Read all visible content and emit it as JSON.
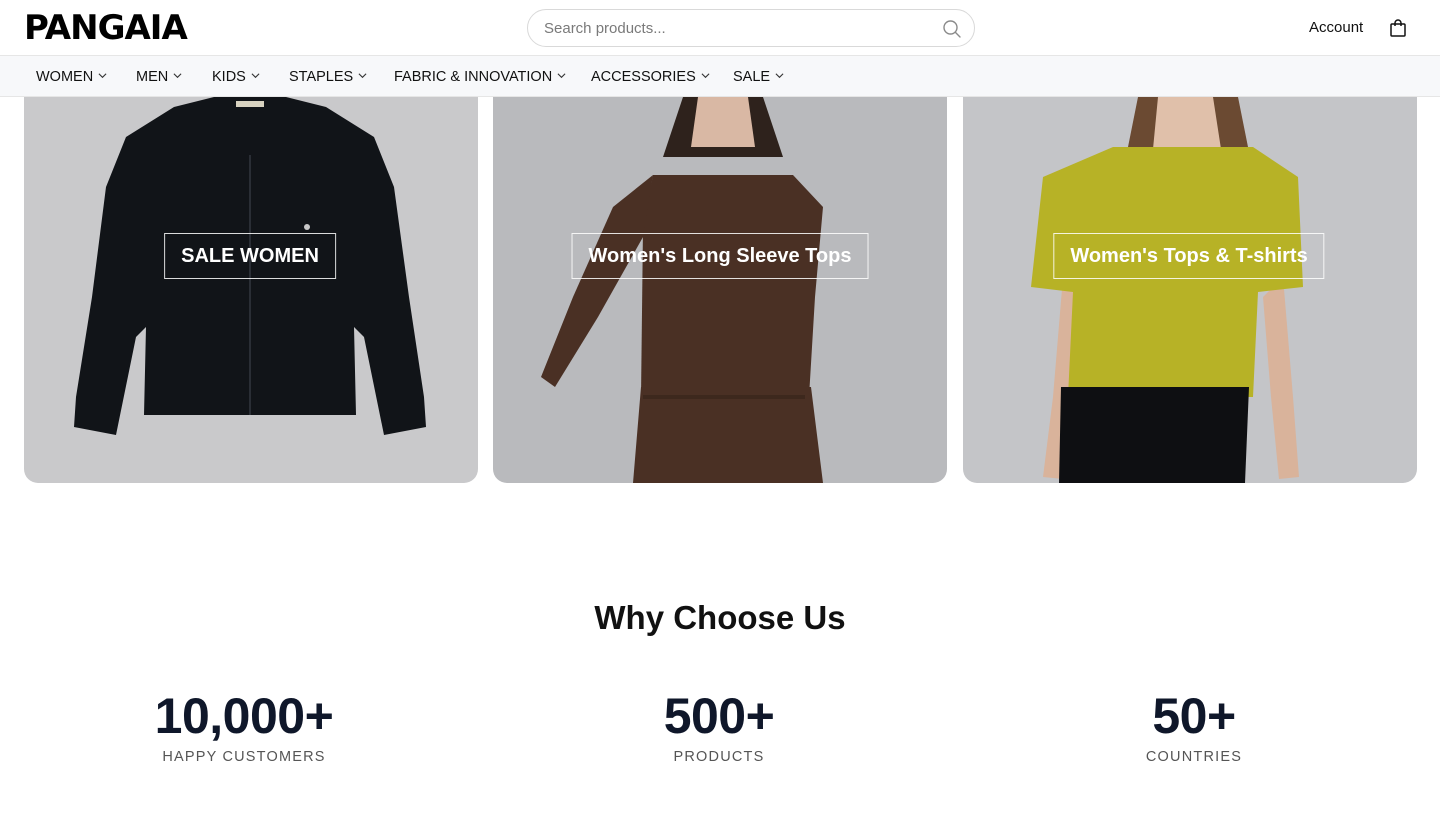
{
  "header": {
    "logo": "PANGAIA",
    "search_placeholder": "Search products...",
    "account_label": "Account"
  },
  "nav": {
    "items": [
      {
        "label": "WOMEN"
      },
      {
        "label": "MEN"
      },
      {
        "label": "KIDS"
      },
      {
        "label": "STAPLES"
      },
      {
        "label": "FABRIC & INNOVATION"
      },
      {
        "label": "ACCESSORIES"
      },
      {
        "label": "SALE"
      }
    ]
  },
  "categories": [
    {
      "label": "SALE WOMEN",
      "garment_color": "#111418",
      "background": "#c9c9cb"
    },
    {
      "label": "Women's Long Sleeve Tops",
      "garment_color": "#4a3024",
      "background": "#b9babd"
    },
    {
      "label": "Women's Tops & T-shirts",
      "garment_color": "#b7b226",
      "background": "#c4c5c8"
    }
  ],
  "why": {
    "title": "Why Choose Us",
    "stats": [
      {
        "value": "10,000+",
        "label": "HAPPY CUSTOMERS"
      },
      {
        "value": "500+",
        "label": "PRODUCTS"
      },
      {
        "value": "50+",
        "label": "COUNTRIES"
      }
    ]
  }
}
